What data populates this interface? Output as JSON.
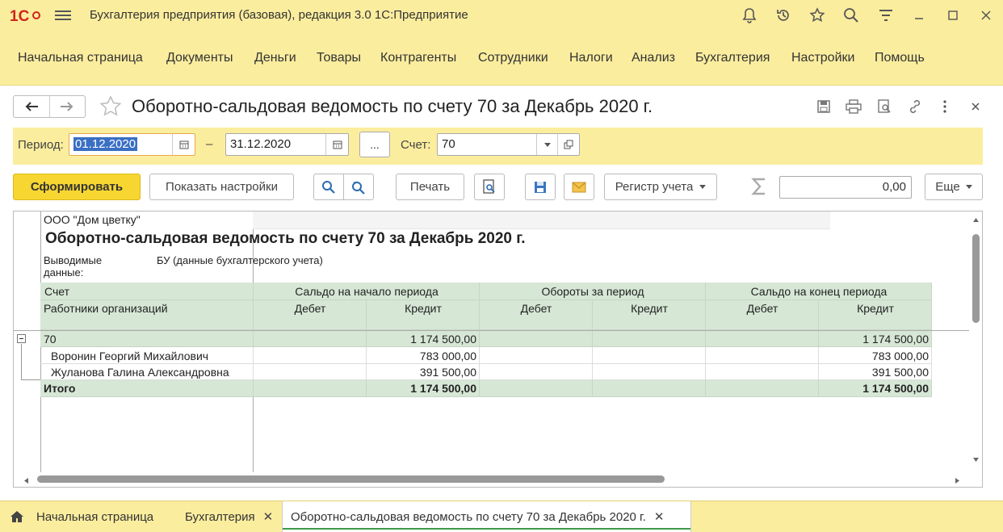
{
  "app": {
    "title": "Бухгалтерия предприятия (базовая), редакция 3.0 1С:Предприятие",
    "logo_text": "1С"
  },
  "sections": [
    {
      "label": "Начальная страница"
    },
    {
      "label": "Документы"
    },
    {
      "label": "Деньги"
    },
    {
      "label": "Товары"
    },
    {
      "label": "Контрагенты"
    },
    {
      "label": "Сотрудники"
    },
    {
      "label": "Налоги"
    },
    {
      "label": "Анализ"
    },
    {
      "label": "Бухгалтерия"
    },
    {
      "label": "Настройки"
    },
    {
      "label": "Помощь"
    }
  ],
  "form": {
    "title": "Оборотно-сальдовая ведомость по счету 70 за Декабрь 2020 г.",
    "period_label": "Период:",
    "period_from": "01.12.2020",
    "period_dash": "–",
    "period_to": "31.12.2020",
    "dots": "...",
    "account_label": "Счет:",
    "account_value": "70"
  },
  "toolbar": {
    "generate": "Сформировать",
    "show_settings": "Показать настройки",
    "print": "Печать",
    "register": "Регистр учета",
    "sum_value": "0,00",
    "more": "Еще"
  },
  "report": {
    "org": "ООО \"Дом цветку\"",
    "title": "Оборотно-сальдовая ведомость по счету 70 за Декабрь 2020 г.",
    "output_label": "Выводимые данные:",
    "output_value": "БУ (данные бухгалтерского учета)",
    "col_account": "Счет",
    "col_employees": "Работники организаций",
    "group_start": "Сальдо на начало периода",
    "group_turnover": "Обороты за период",
    "group_end": "Сальдо на конец периода",
    "debit": "Дебет",
    "credit": "Кредит",
    "rows": [
      {
        "name": "70",
        "start_credit": "1 174 500,00",
        "end_credit": "1 174 500,00"
      },
      {
        "name": "Воронин Георгий Михайлович",
        "start_credit": "783 000,00",
        "end_credit": "783 000,00"
      },
      {
        "name": "Жуланова Галина Александровна",
        "start_credit": "391 500,00",
        "end_credit": "391 500,00"
      }
    ],
    "total": {
      "name": "Итого",
      "start_credit": "1 174 500,00",
      "end_credit": "1 174 500,00"
    }
  },
  "tabs": [
    {
      "label": "Начальная страница"
    },
    {
      "label": "Бухгалтерия"
    },
    {
      "label": "Оборотно-сальдовая ведомость по счету 70 за Декабрь 2020 г."
    }
  ],
  "colors": {
    "accent": "#fbed9e",
    "primary_button": "#f7d631",
    "header_green": "#d6e7d5",
    "logo_red": "#d0251a"
  }
}
